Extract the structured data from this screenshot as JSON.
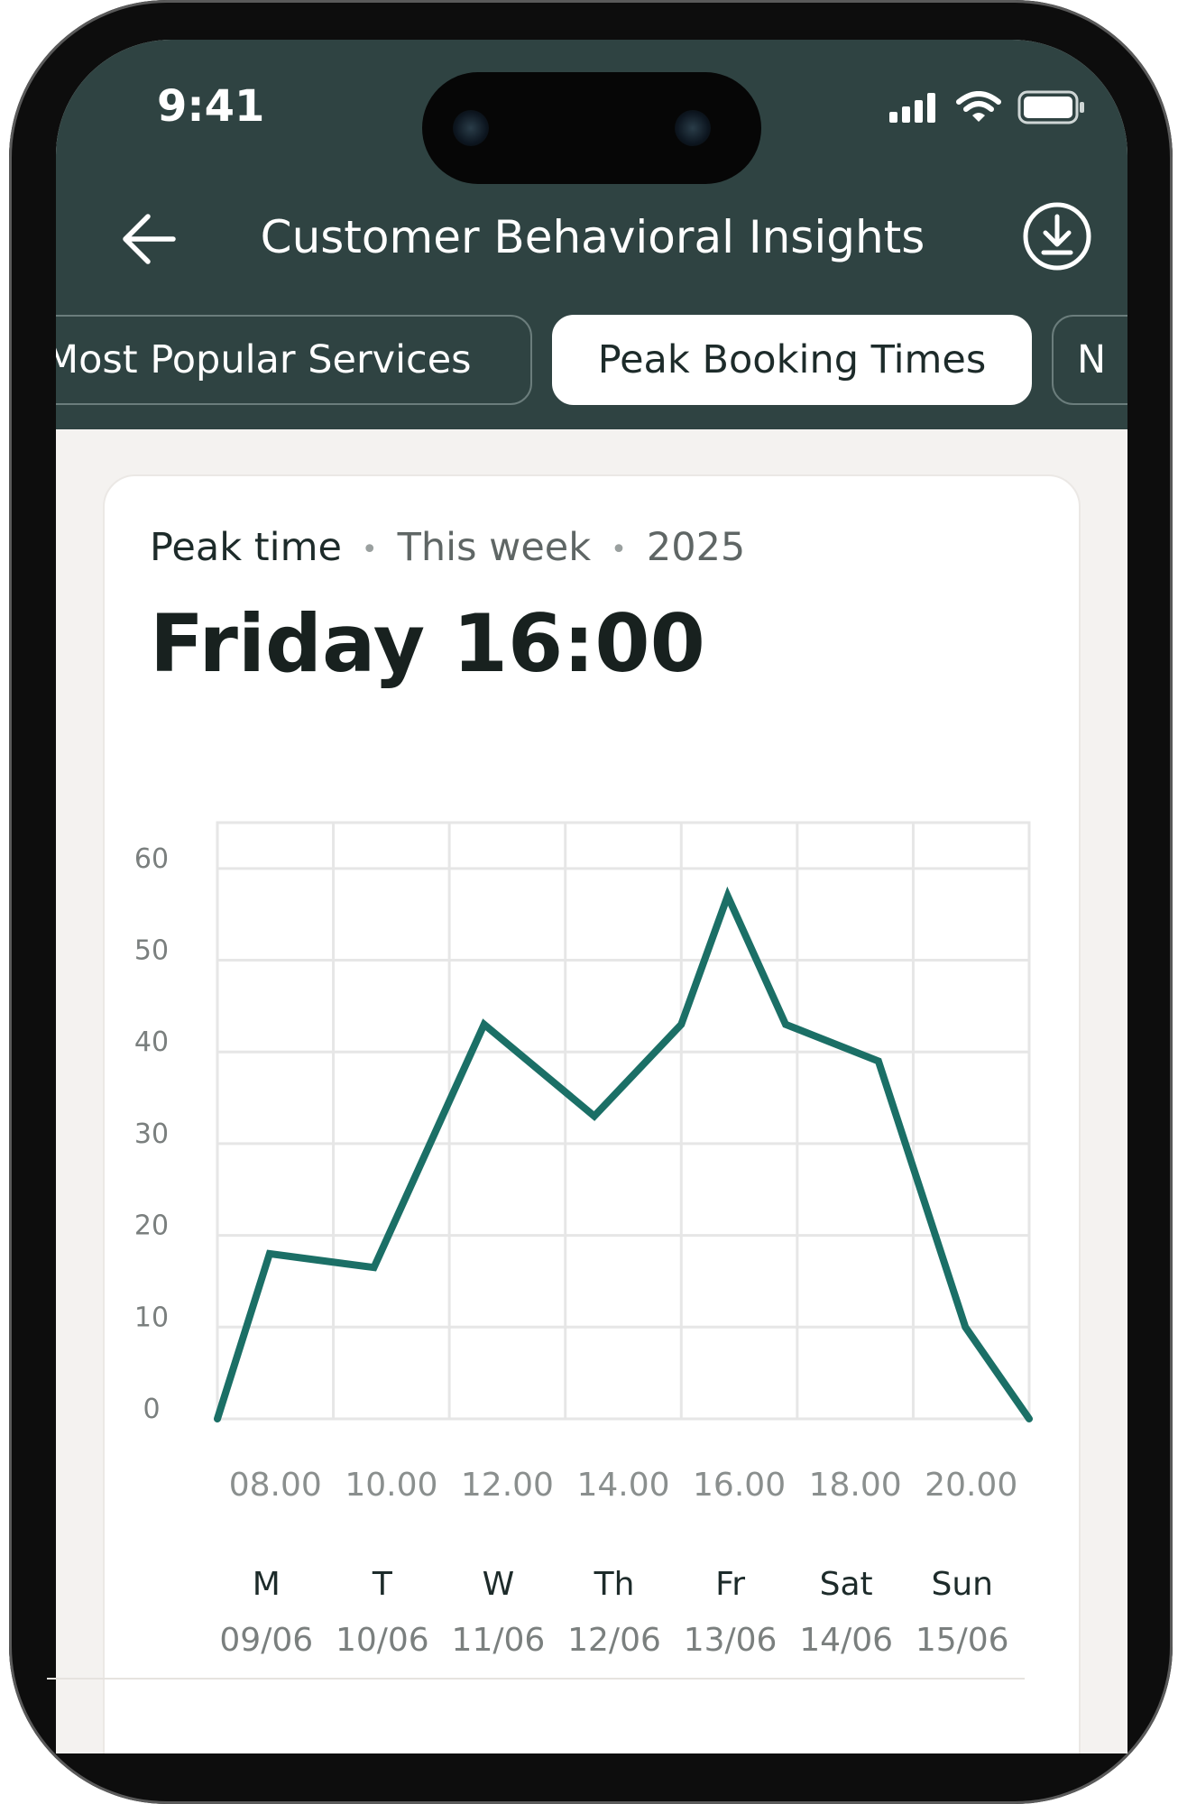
{
  "status_bar": {
    "time": "9:41"
  },
  "header": {
    "title": "Customer Behavioral Insights",
    "back_icon": "arrow-left-icon",
    "download_icon": "download-circle-icon"
  },
  "tabs": [
    {
      "label": "Most Popular Services",
      "selected": false
    },
    {
      "label": "Peak Booking Times",
      "selected": true
    },
    {
      "label": "N",
      "selected": false
    }
  ],
  "card": {
    "label": "Peak time",
    "period": "This week",
    "year": "2025",
    "headline": "Friday 16:00"
  },
  "colors": {
    "header_bg": "#2f4342",
    "line": "#1b6f66",
    "grid": "#e6e6e6",
    "screen_bg": "#f4f2f0"
  },
  "chart_data": {
    "type": "line",
    "y_ticks": [
      "60",
      "50",
      "40",
      "30",
      "20",
      "10",
      "0"
    ],
    "ylim": [
      0,
      65
    ],
    "x_tick_labels": [
      "08.00",
      "10.00",
      "12.00",
      "14.00",
      "16.00",
      "18.00",
      "20.00"
    ],
    "day_labels": [
      "M",
      "T",
      "W",
      "Th",
      "Fr",
      "Sat",
      "Sun"
    ],
    "date_labels": [
      "09/06",
      "10/06",
      "11/06",
      "12/06",
      "13/06",
      "14/06",
      "15/06"
    ],
    "grid": true,
    "series": [
      {
        "x": [
          0,
          0.45,
          1.35,
          2.3,
          3.25,
          4.0,
          4.4,
          4.9,
          5.7,
          6.45,
          7.0
        ],
        "values": [
          0,
          18,
          16.5,
          43,
          33,
          43,
          57,
          43,
          39,
          10,
          0
        ]
      }
    ]
  }
}
